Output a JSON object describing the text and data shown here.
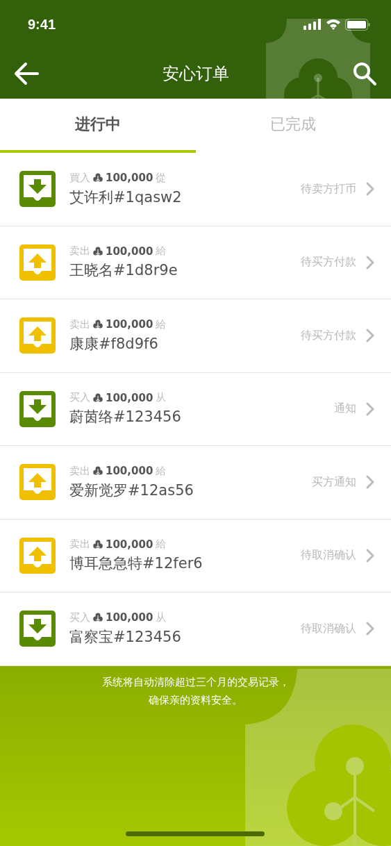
{
  "status_bar": {
    "time": "9:41"
  },
  "nav": {
    "title": "安心订单"
  },
  "tabs": [
    {
      "label": "进行中",
      "selected": true
    },
    {
      "label": "已完成",
      "selected": false
    }
  ],
  "orders": [
    {
      "kind": "buy",
      "verb": "買入",
      "amount": "100,000",
      "preposition": "從",
      "party": "艾许利#1qasw2",
      "status": "待卖方打币"
    },
    {
      "kind": "sell",
      "verb": "卖出",
      "amount": "100,000",
      "preposition": "給",
      "party": "王晓名#1d8r9e",
      "status": "待买方付款"
    },
    {
      "kind": "sell",
      "verb": "卖出",
      "amount": "100,000",
      "preposition": "給",
      "party": "康康#f8d9f6",
      "status": "待买方付款"
    },
    {
      "kind": "buy",
      "verb": "买入",
      "amount": "100,000",
      "preposition": "从",
      "party": "蔚茵络#123456",
      "status": "通知"
    },
    {
      "kind": "sell",
      "verb": "卖出",
      "amount": "100,000",
      "preposition": "給",
      "party": "爱新觉罗#12as56",
      "status": "买方通知"
    },
    {
      "kind": "sell",
      "verb": "卖出",
      "amount": "100,000",
      "preposition": "給",
      "party": "博耳急急特#12fer6",
      "status": "待取消确认"
    },
    {
      "kind": "buy",
      "verb": "买入",
      "amount": "100,000",
      "preposition": "从",
      "party": "富察宝#123456",
      "status": "待取消确认"
    }
  ],
  "notice": [
    "系统将自动清除超过三个月的交易记录，",
    "确保亲的资料安全。"
  ]
}
